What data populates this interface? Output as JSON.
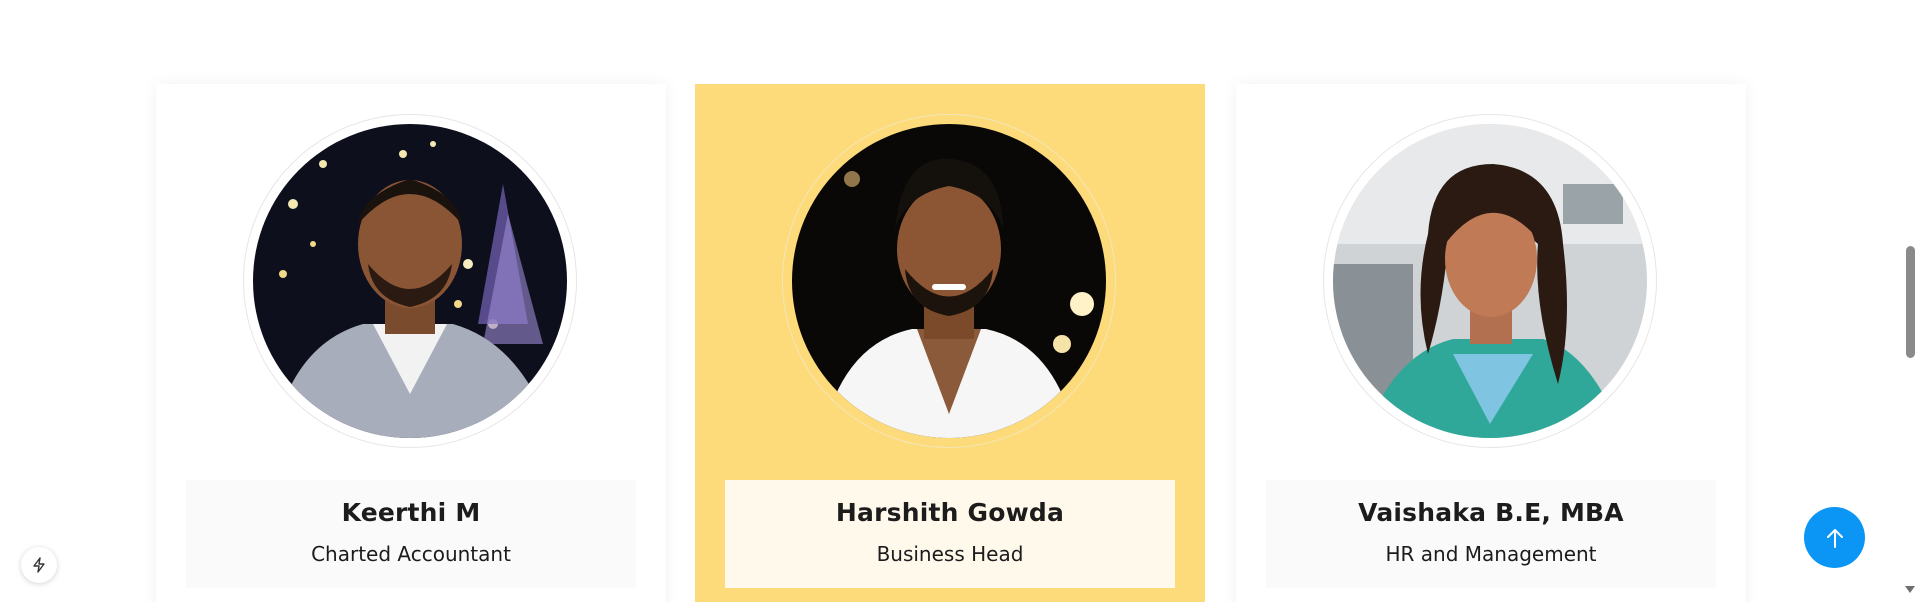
{
  "team": {
    "members": [
      {
        "name": "Keerthi M",
        "role": "Charted Accountant"
      },
      {
        "name": "Harshith Gowda",
        "role": "Business Head"
      },
      {
        "name": "Vaishaka B.E, MBA",
        "role": "HR and Management"
      }
    ],
    "active_index": 1
  },
  "colors": {
    "active_card": "#fddb7a",
    "active_info_box": "#fff9ec",
    "scroll_top_button": "#0b96f5",
    "text": "#1c1c1c"
  },
  "icons": {
    "scroll_top": "arrow-up-icon",
    "widget": "lightning-bolt-icon"
  }
}
